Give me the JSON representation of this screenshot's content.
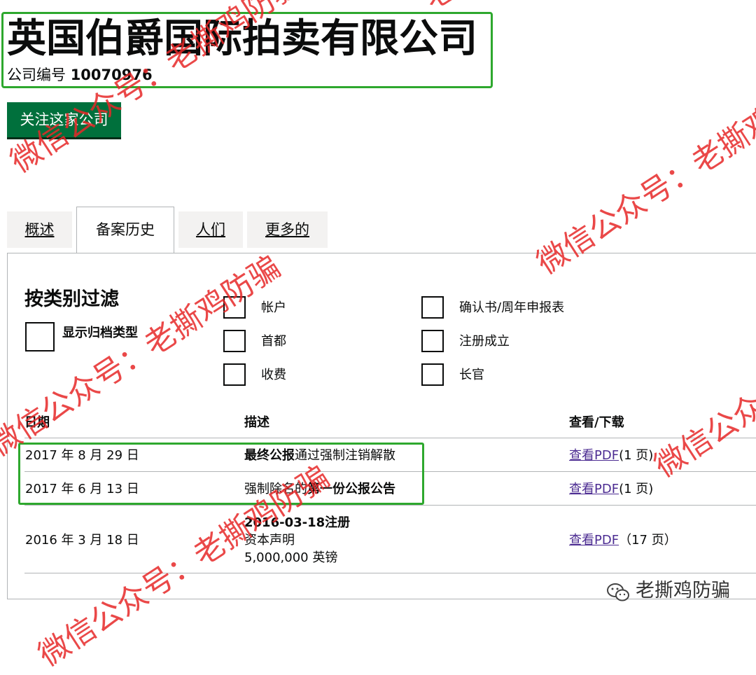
{
  "header": {
    "company_name": "英国伯爵国际拍卖有限公司",
    "company_number_label": "公司编号",
    "company_number": "10070976",
    "follow_button": "关注这家公司"
  },
  "tabs": [
    {
      "label": "概述"
    },
    {
      "label": "备案历史"
    },
    {
      "label": "人们"
    },
    {
      "label": "更多的"
    }
  ],
  "filter": {
    "title": "按类别过滤",
    "show_types_label": "显示归档类型",
    "options": [
      "帐户",
      "首都",
      "收费",
      "确认书/周年申报表",
      "注册成立",
      "长官"
    ]
  },
  "table": {
    "headers": {
      "date": "日期",
      "description": "描述",
      "view": "查看/下载"
    },
    "rows": [
      {
        "date": "2017 年 8 月 29 日",
        "desc_bold": "最终公报",
        "desc_rest": "通过强制注销解散",
        "link": "查看PDF",
        "pages": "(1 页)"
      },
      {
        "date": "2017 年 6 月 13 日",
        "desc_pre": "强制除名的",
        "desc_bold": "第一份公报公告",
        "link": "查看PDF",
        "pages": "(1 页)"
      },
      {
        "date": "2016 年 3 月 18 日",
        "desc_title": "2016-03-18注册",
        "desc_line2": "资本声明",
        "desc_line3": "5,000,000 英镑",
        "link": "查看PDF",
        "pages": "（17 页）"
      }
    ]
  },
  "watermarks": {
    "text_a": "微信公众号：老撕鸡防骗",
    "text_b": "老撕鸡防骗",
    "brand": "老撕鸡防骗",
    "color": "#e62828"
  },
  "colors": {
    "follow_button": "#00703c",
    "highlight_border": "#2ea82e",
    "link": "#4c2c92"
  }
}
